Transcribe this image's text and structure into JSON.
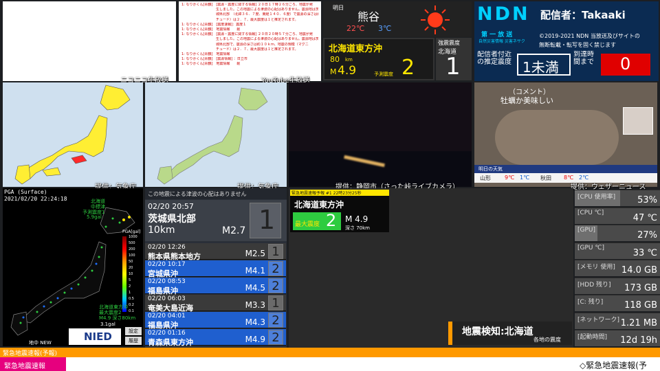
{
  "chat_left": {
    "lines": []
  },
  "chat_right": {
    "lines": [
      "1: なりかくん[青鶴]　[震源・震度に関する情報] ２０日１７時２６分ごろ、地震が発",
      "　　　　　　　　　　生しました。この地震による津波の心配はありません。震源地は茨",
      "　　　　　　　　　　城県北部　（北緯３６．７度、東経１４０．６度）で震源の深さは約１０ｋｍ、地震の規模（マグニ",
      "　　　　　　　　　　チュード）は２．７、最大震度は１と推定されます。",
      "1: なりかくん[青鶴]　[震度速報]：震度１",
      "1: なりかくん[青鶴]　地震情報　　削",
      "1: なりかくん[青鶴]　[震源・震度に関する情報] ２０日２０時５７分ごろ、地震が発",
      "　　　　　　　　　　生しました。この地震による津波の心配はありません。震源地は茨",
      "　　　　　　　　　　城県北部で、震源の深さは約１０ｋｍ、地震の規模（マグニ",
      "　　　　　　　　　　チュード）は２．７、最大震度は１と推定されます。",
      "1: なりかくん[青鶴]　地震情報",
      "1: なりかくん[青鶴]　[震源情報] ：日立市",
      "1: なりかくん[青鶴]　地震情報　　削"
    ]
  },
  "labels": {
    "niconico": "ニコニコ生放送",
    "youtube": "YouTube生放送",
    "jma1": "提供：気象庁",
    "jma2": "提供：気象庁",
    "shizuoka": "提供：静岡市（さった峠ライブカメラ）",
    "weathernews": "提供：ウェザーニュース"
  },
  "weather": {
    "day": "明日",
    "city": "熊谷",
    "high": "22℃",
    "low": "3℃",
    "icon": "sun-icon"
  },
  "eew_box": {
    "region": "北海道東方沖",
    "depth": "80",
    "depth_unit": "km",
    "mag_prefix": "M",
    "mag": "4.9",
    "pred_label": "予測震度",
    "pred": "2",
    "strong_label": "強震震度",
    "strong_region": "北海道",
    "strong_value": "1"
  },
  "ndn": {
    "logo": "NDN",
    "streamer": "配信者：Takaaki",
    "sub1": "第 一 放 送",
    "sub2": "自然災害情報 災害ネサク",
    "copyright1": "©2019-2021 NDN 当放送及びサイトの",
    "copyright2": "無断転載・転写を固く禁じます",
    "nearby_label": "配信者付近の推定震度",
    "nearby_value": "1未満",
    "arrival_label": "到達時間まで",
    "arrival_value": "0"
  },
  "wn": {
    "comment_label": "（コメント）",
    "comment_text": "牡蠣か美味しい",
    "tomorrow": "明日の天気",
    "cities": [
      {
        "name": "山形",
        "hi": "9℃",
        "lo": "1℃"
      },
      {
        "name": "秋田",
        "hi": "8℃",
        "lo": "2℃"
      }
    ]
  },
  "pga": {
    "title": "PGA (Surface)",
    "time": "2021/02/20 22:24:18",
    "note1": "北海道",
    "note2": "中標津",
    "note3": "予測震度1",
    "note4": "5.9gal",
    "legend_unit": "PGA[gal]",
    "legend_ticks": [
      "1000",
      "500",
      "200",
      "100",
      "50",
      "20",
      "10",
      "5",
      "2",
      "1",
      "0.5",
      "0.2",
      "0.1"
    ],
    "note5": "北海道東方沖",
    "note6": "最大震度2",
    "note7": "M4.9 深さ80km",
    "note8": "3.1gal",
    "footer": "地中 NEW",
    "logo": "NIED",
    "btn_settings": "設定",
    "btn_history": "履歴"
  },
  "quake": {
    "tsunami": "この地震による津波の心配はありません",
    "datetime": "02/20 20:57",
    "place": "茨城県北部",
    "depth": "10km",
    "mag": "M2.7",
    "intensity": "1",
    "history": [
      {
        "dt": "02/20 12:26",
        "place": "熊本県熊本地方",
        "mag": "M2.5",
        "int": "1",
        "color": "#3a3a3a"
      },
      {
        "dt": "02/20 10:17",
        "place": "宮城県沖",
        "mag": "M4.1",
        "int": "2",
        "color": "#1f5fcf"
      },
      {
        "dt": "02/20 08:53",
        "place": "福島県沖",
        "mag": "M4.5",
        "int": "2",
        "color": "#1f5fcf"
      },
      {
        "dt": "02/20 06:03",
        "place": "奄美大島近海",
        "mag": "M3.3",
        "int": "1",
        "color": "#3a3a3a"
      },
      {
        "dt": "02/20 04:01",
        "place": "福島県沖",
        "mag": "M4.3",
        "int": "2",
        "color": "#1f5fcf"
      },
      {
        "dt": "02/20 01:16",
        "place": "青森県東方沖",
        "mag": "M4.9",
        "int": "2",
        "color": "#1f5fcf"
      }
    ]
  },
  "eew_small": {
    "header": "緊急地震速報予報 #1 22時23分25秒",
    "region": "北海道東方沖",
    "max_label": "最大震度",
    "max_value": "2",
    "mag": "M 4.9",
    "depth": "深さ 70km"
  },
  "detect": {
    "title": "地震検知:北海道",
    "sub": "各地の震度"
  },
  "perf": [
    {
      "label": "[CPU 使用率]",
      "value": "53%",
      "fill": 0.53
    },
    {
      "label": "[CPU ℃]",
      "value": "47 ℃",
      "fill": 0
    },
    {
      "label": "[GPU]",
      "value": "27%",
      "fill": 0.27
    },
    {
      "label": "[GPU ℃]",
      "value": "33 ℃",
      "fill": 0
    },
    {
      "label": "[メモリ 使用]",
      "value": "14.0 GB",
      "fill": 0
    },
    {
      "label": "[HDD 残り]",
      "value": "173 GB",
      "fill": 0
    },
    {
      "label": "[C: 残り]",
      "value": "118 GB",
      "fill": 0
    },
    {
      "label": "[ネットワーク]",
      "value": "1.21 MB",
      "fill": 0
    },
    {
      "label": "[起動時間]",
      "value": "12d 19h",
      "fill": 0
    }
  ],
  "bottom": {
    "bar1": "緊急地震速報(予報)",
    "bar2": "緊急地震速報",
    "ticker": "◇緊急地震速報(予"
  },
  "colors": {
    "accent": "#ff9900",
    "alert_red": "#e00000",
    "quake_blue": "#1f5fcf",
    "ndn_cyan": "#00d0ff"
  }
}
